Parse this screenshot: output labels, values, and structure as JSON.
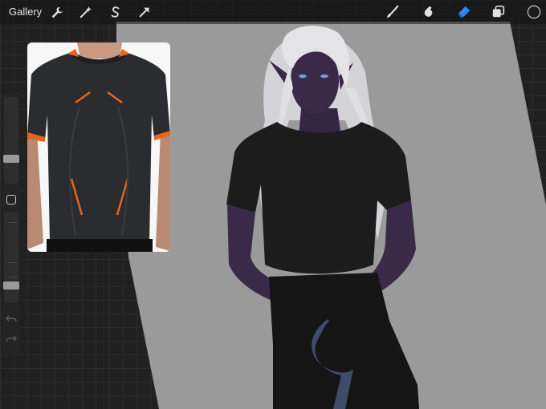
{
  "topbar": {
    "gallery_label": "Gallery",
    "left_tools": [
      {
        "icon": "wrench-icon"
      },
      {
        "icon": "magic-wand-icon"
      },
      {
        "icon": "selection-s-icon"
      },
      {
        "icon": "transform-arrow-icon"
      }
    ],
    "right_tools": [
      {
        "icon": "brush-icon"
      },
      {
        "icon": "smudge-icon"
      },
      {
        "icon": "eraser-icon",
        "active_color": "#2f86f6"
      },
      {
        "icon": "layers-icon"
      },
      {
        "icon": "color-circle-icon",
        "color": "#1a1a1a"
      }
    ]
  },
  "sidebar": {
    "brush_size_level": 0.55,
    "opacity_level": 0.78,
    "modify_icon": "square-modify-icon",
    "undo_icon": "undo-icon",
    "redo_icon": "redo-icon"
  },
  "reference": {
    "image": "black-shirt-orange-accents-reference",
    "accent": "#e8641c"
  },
  "canvas": {
    "background": "#9a9a9a",
    "skin": "#3a2a48",
    "hair": "#d9d9dd",
    "shirt": "#1c1c1d",
    "pants": "#151516",
    "eye": "#6ea0d8"
  }
}
